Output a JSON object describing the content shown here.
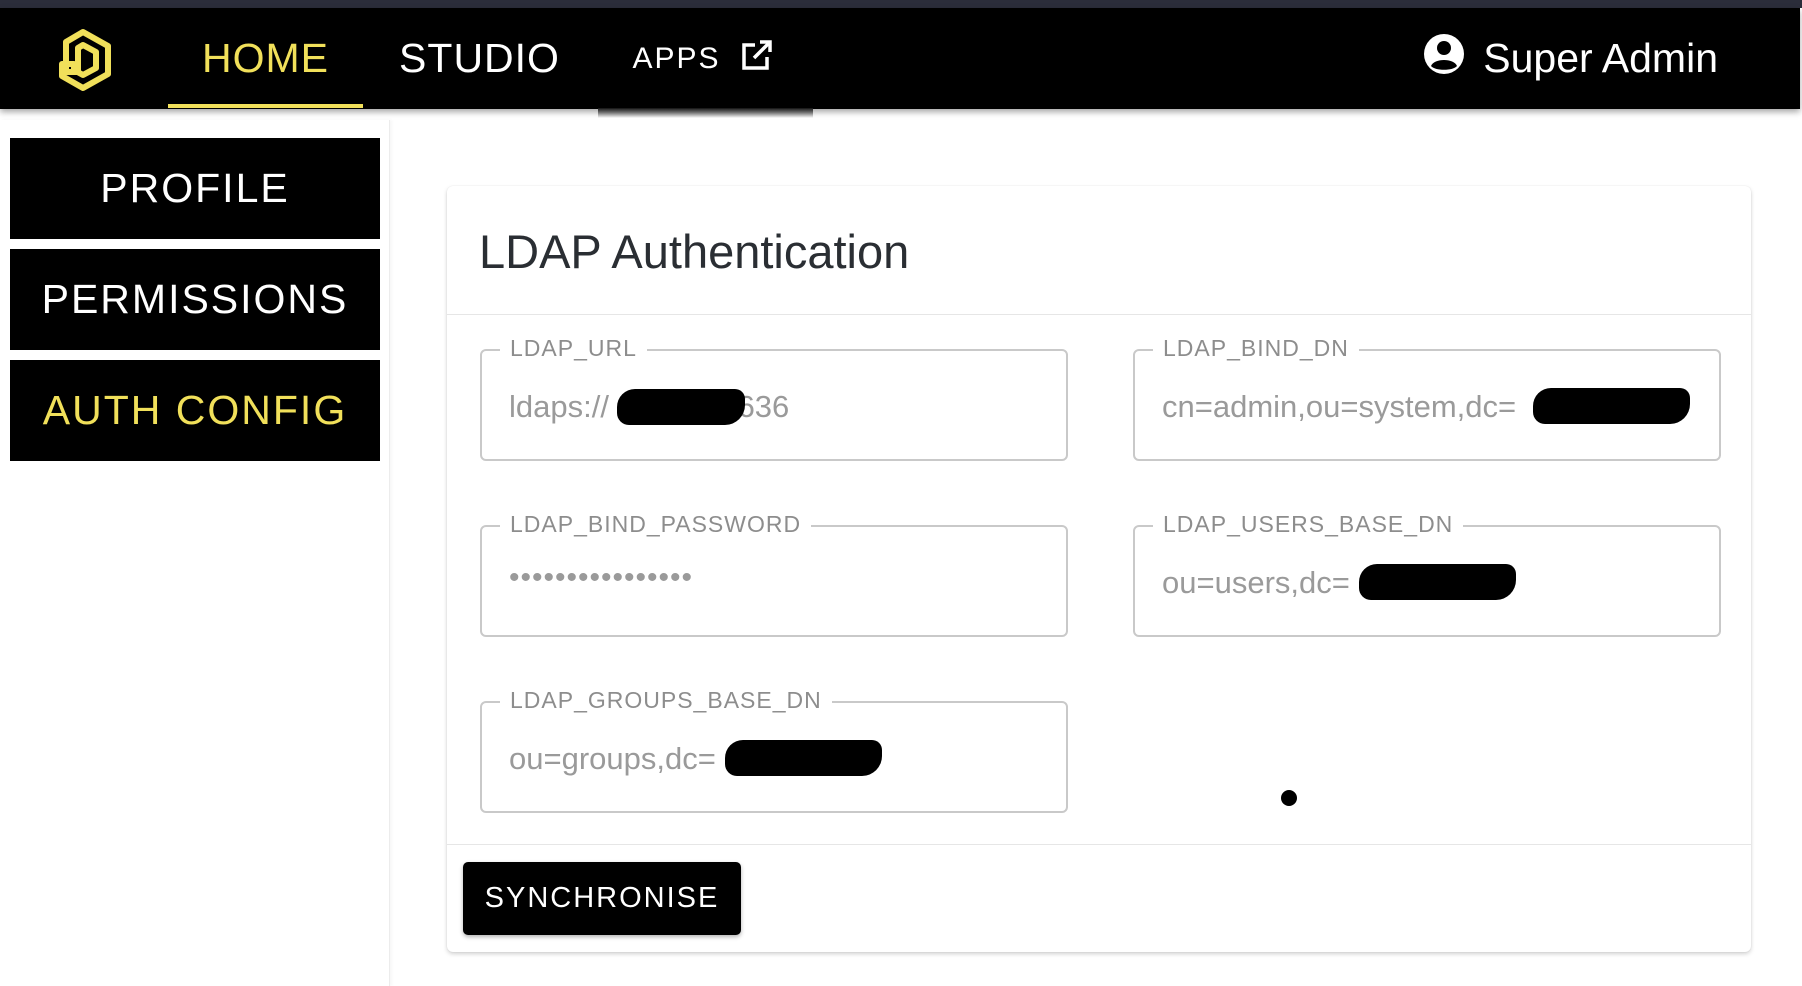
{
  "nav": {
    "tabs": [
      {
        "label": "HOME",
        "active": true
      },
      {
        "label": "STUDIO",
        "active": false
      }
    ],
    "apps_label": "APPS",
    "apps_icon": "external-link-icon",
    "user_name": "Super Admin",
    "user_icon": "account-circle-icon",
    "logo_icon": "app-logo-icon"
  },
  "sidebar": {
    "items": [
      {
        "label": "PROFILE",
        "active": false
      },
      {
        "label": "PERMISSIONS",
        "active": false
      },
      {
        "label": "AUTH CONFIG",
        "active": true
      }
    ]
  },
  "ldap": {
    "title": "LDAP Authentication",
    "fields": {
      "url": {
        "label": "LDAP_URL",
        "value_prefix": "ldaps://",
        "value_suffix": ":636"
      },
      "bind_dn": {
        "label": "LDAP_BIND_DN",
        "value_prefix": "cn=admin,ou=system,dc="
      },
      "bind_password": {
        "label": "LDAP_BIND_PASSWORD",
        "value": "••••••••••••••••"
      },
      "users_base_dn": {
        "label": "LDAP_USERS_BASE_DN",
        "value_prefix": "ou=users,dc="
      },
      "groups_base_dn": {
        "label": "LDAP_GROUPS_BASE_DN",
        "value_prefix": "ou=groups,dc="
      }
    },
    "sync_label": "SYNCHRONISE"
  },
  "colors": {
    "accent": "#f1e05a",
    "nav_background": "#000000",
    "top_strip": "#2b2d3a"
  }
}
